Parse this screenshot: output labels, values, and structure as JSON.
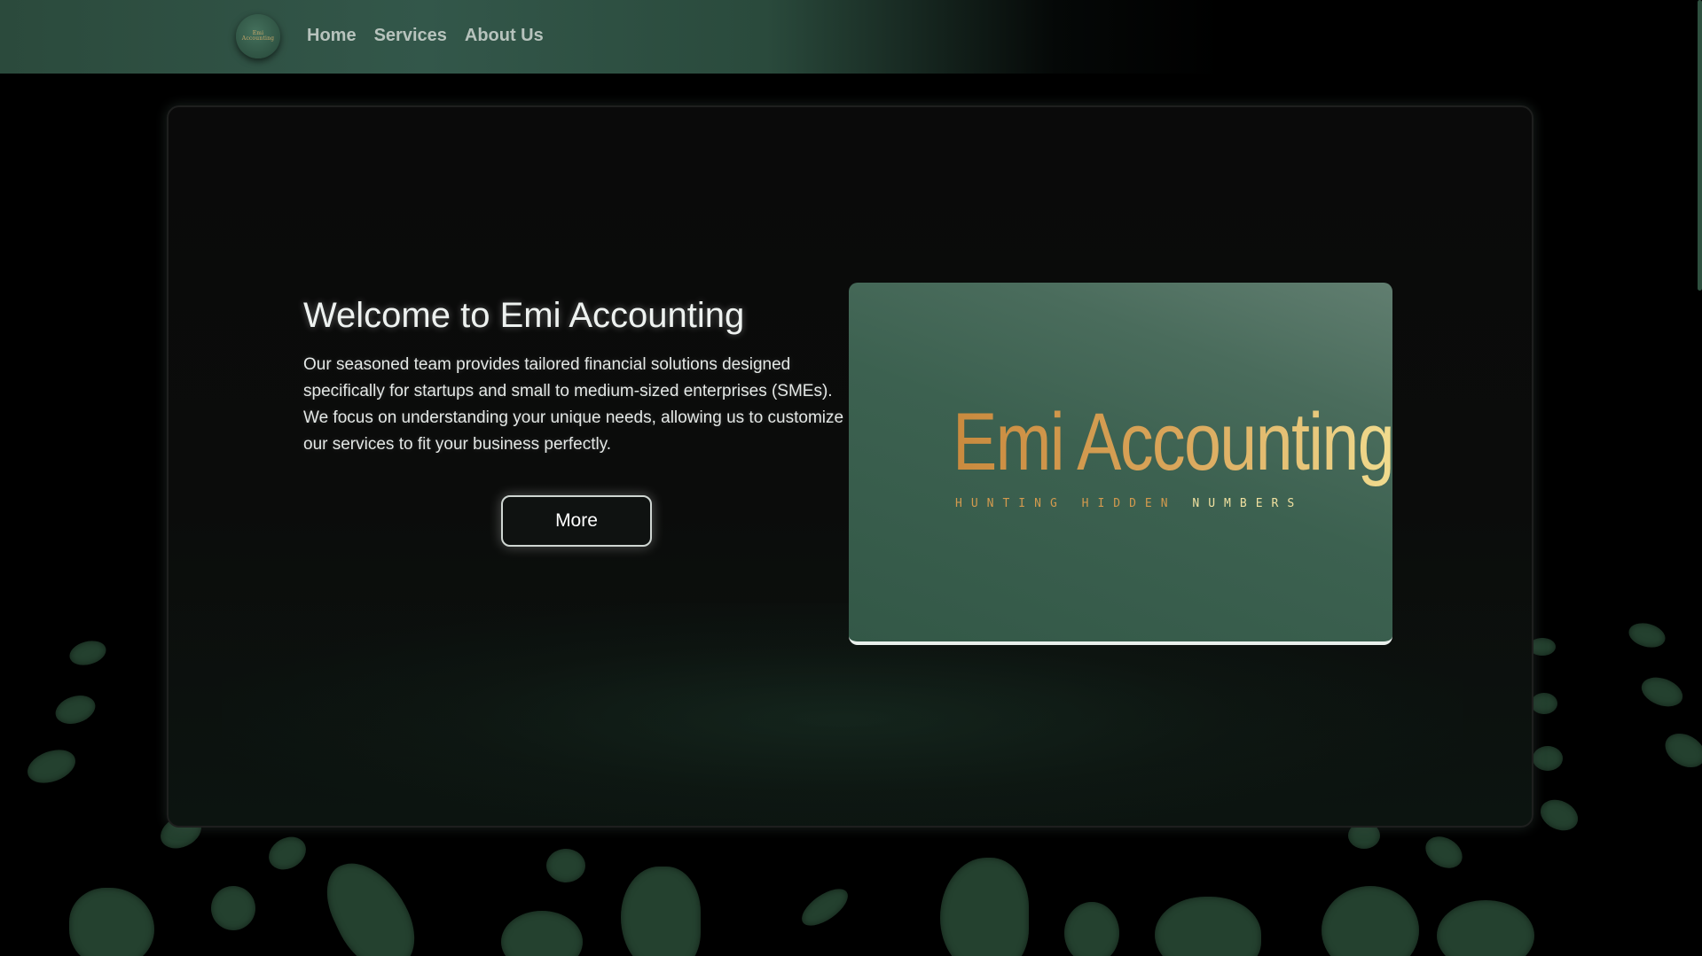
{
  "nav": {
    "logo_text": "Emi Accounting",
    "links": [
      "Home",
      "Services",
      "About Us"
    ]
  },
  "hero": {
    "title": "Welcome to Emi Accounting",
    "description": "Our seasoned team provides tailored financial solutions designed specifically for startups and small to medium-sized enterprises (SMEs). We focus on understanding your unique needs, allowing us to customize our services to fit your business perfectly.",
    "button_label": "More"
  },
  "brand": {
    "name": "Emi Accounting",
    "tagline_part1": "HUNTING HIDDEN",
    "tagline_part2": "NUMBERS"
  },
  "colors": {
    "accent_green": "#33574a",
    "gold": "#d9a55a",
    "background": "#000000"
  }
}
